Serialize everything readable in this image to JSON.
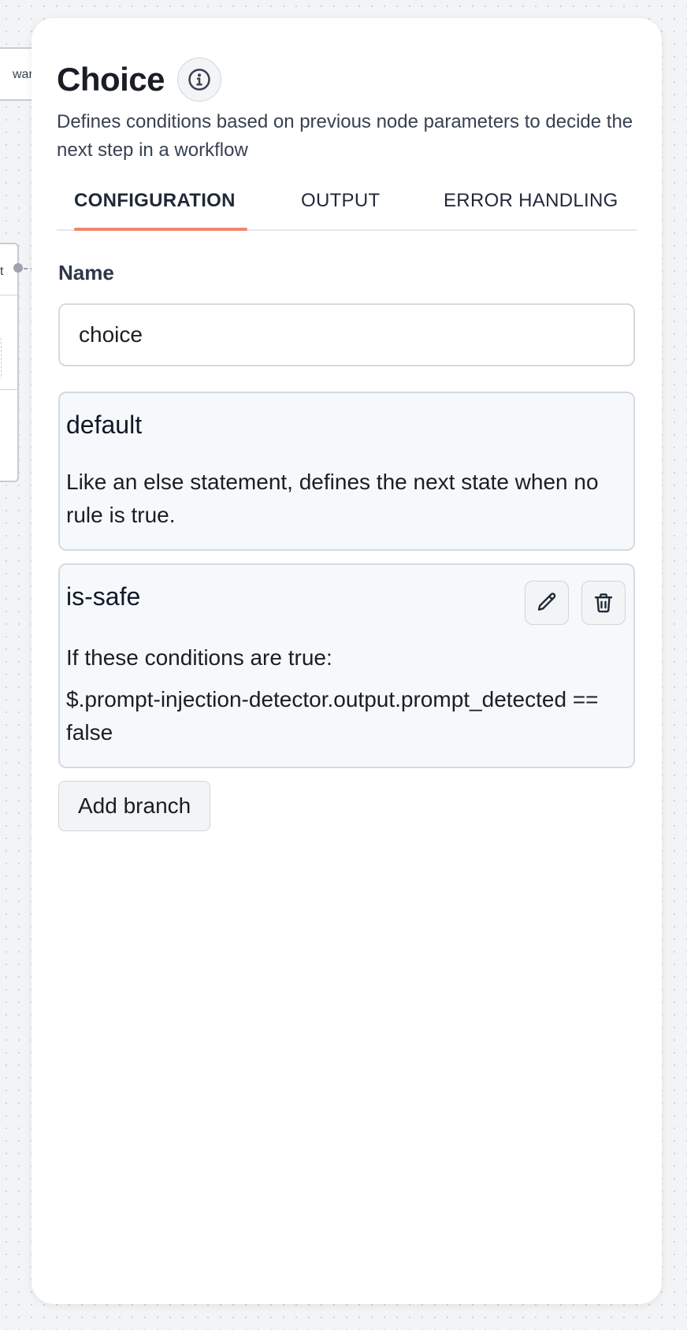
{
  "canvas": {
    "top_node_label": "war",
    "mid_node_label": "t"
  },
  "panel": {
    "title": "Choice",
    "info_icon": "info-icon",
    "subtitle": "Defines conditions based on previous node parameters to decide the next step in a workflow",
    "tabs": [
      {
        "label": "CONFIGURATION",
        "active": true
      },
      {
        "label": "OUTPUT",
        "active": false
      },
      {
        "label": "ERROR HANDLING",
        "active": false
      }
    ],
    "accent_color": "#f0876e"
  },
  "form": {
    "name_label": "Name",
    "name_value": "choice"
  },
  "branches": [
    {
      "name": "default",
      "description": "Like an else statement, defines the next state when no rule is true."
    },
    {
      "name": "is-safe",
      "condition_label": "If these conditions are true:",
      "expression": "$.prompt-injection-detector.output.prompt_detected == false",
      "edit_icon": "pencil-icon",
      "delete_icon": "trash-icon"
    }
  ],
  "actions": {
    "add_branch_label": "Add branch"
  }
}
